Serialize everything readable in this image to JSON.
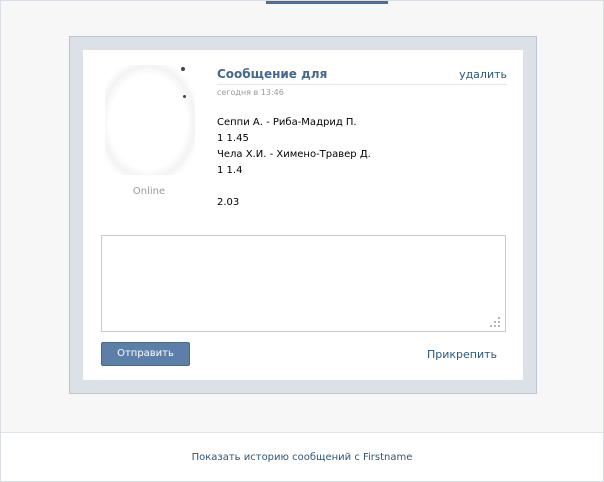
{
  "message": {
    "title": "Сообщение для",
    "delete_label": "удалить",
    "timestamp": "сегодня в 13:46",
    "lines": [
      "Сеппи А. - Риба-Мадрид П.",
      "1 1.45",
      "Чела Х.И. - Химено-Травер Д.",
      "1 1.4",
      "",
      "2.03"
    ]
  },
  "sender": {
    "status": "Online"
  },
  "reply": {
    "value": "",
    "send_label": "Отправить",
    "attach_label": "Прикрепить"
  },
  "footer": {
    "history_label": "Показать историю сообщений с Firstname"
  },
  "colors": {
    "accent": "#45688e",
    "button": "#5b7fa6",
    "link": "#2b587a",
    "dialog_bg": "#dbe1e7"
  }
}
